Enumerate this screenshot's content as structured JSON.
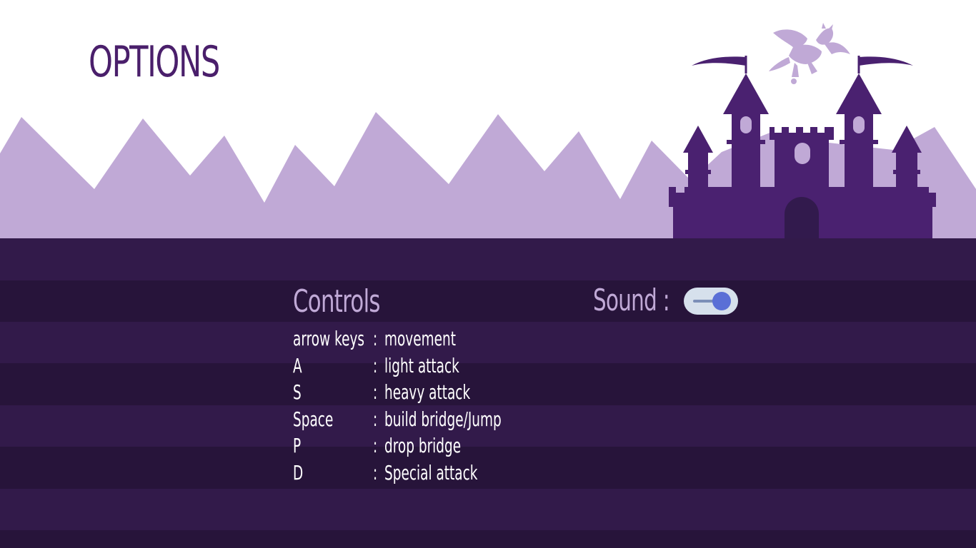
{
  "screen": {
    "title": "OPTIONS"
  },
  "controls": {
    "heading": "Controls",
    "separator": ":",
    "rows": [
      {
        "key": "arrow keys",
        "action": "movement"
      },
      {
        "key": "A",
        "action": "light attack"
      },
      {
        "key": "S",
        "action": "heavy attack"
      },
      {
        "key": "Space",
        "action": "build bridge/Jump"
      },
      {
        "key": "P",
        "action": "drop bridge"
      },
      {
        "key": "D",
        "action": "Special attack"
      }
    ]
  },
  "sound": {
    "label": "Sound :",
    "enabled": true
  },
  "colors": {
    "sky": "#ffffff",
    "mountains": "#c0a9d6",
    "castle": "#4a2170",
    "castle_dark": "#321a4d",
    "stripe_light": "#321a4a",
    "stripe_dark": "#27143a",
    "title": "#4a1f6b",
    "heading": "#c0a9d6",
    "text": "#ffffff",
    "toggle_track": "#d6e0ec",
    "toggle_knob": "#5a6fd6",
    "dragon": "#c0a9d6"
  },
  "scene": {
    "decorations": [
      "mountain-range",
      "castle",
      "dragon-icon",
      "flag-pennants"
    ]
  }
}
